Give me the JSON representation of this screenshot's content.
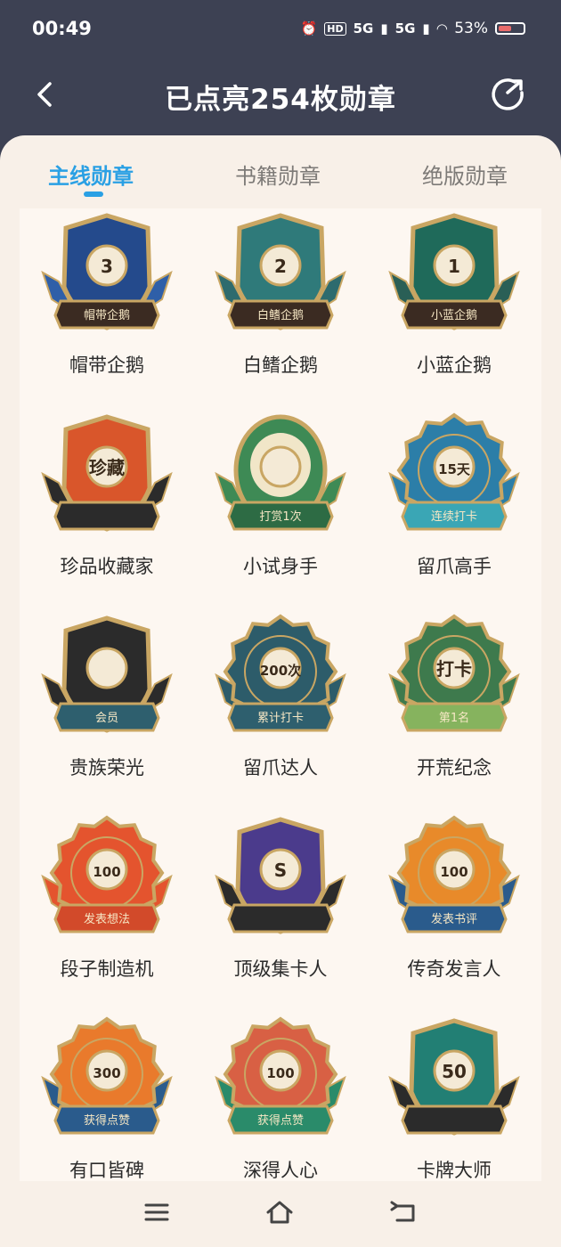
{
  "status_bar": {
    "time": "00:49",
    "network_1": "5G",
    "network_2": "5G",
    "battery": "53%"
  },
  "header": {
    "title": "已点亮254枚勋章"
  },
  "tabs": [
    {
      "label": "主线勋章",
      "active": true
    },
    {
      "label": "书籍勋章",
      "active": false
    },
    {
      "label": "绝版勋章",
      "active": false
    }
  ],
  "badges": [
    {
      "name": "帽带企鹅",
      "ribbon": "帽带企鹅",
      "center": "3"
    },
    {
      "name": "白鳍企鹅",
      "ribbon": "白鳍企鹅",
      "center": "2"
    },
    {
      "name": "小蓝企鹅",
      "ribbon": "小蓝企鹅",
      "center": "1"
    },
    {
      "name": "珍品收藏家",
      "ribbon": "",
      "center": "珍藏"
    },
    {
      "name": "小试身手",
      "ribbon": "打赏1次",
      "center": ""
    },
    {
      "name": "留爪高手",
      "ribbon": "连续打卡",
      "center": "15天"
    },
    {
      "name": "贵族荣光",
      "ribbon": "会员",
      "center": ""
    },
    {
      "name": "留爪达人",
      "ribbon": "累计打卡",
      "center": "200次"
    },
    {
      "name": "开荒纪念",
      "ribbon": "第1名",
      "center": "打卡"
    },
    {
      "name": "段子制造机",
      "ribbon": "发表想法",
      "center": "100"
    },
    {
      "name": "顶级集卡人",
      "ribbon": "",
      "center": "S"
    },
    {
      "name": "传奇发言人",
      "ribbon": "发表书评",
      "center": "100"
    },
    {
      "name": "有口皆碑",
      "ribbon": "获得点赞",
      "center": "300"
    },
    {
      "name": "深得人心",
      "ribbon": "获得点赞",
      "center": "100"
    },
    {
      "name": "卡牌大师",
      "ribbon": "",
      "center": "50"
    }
  ],
  "colors": {
    "active_tab": "#2aa0e4",
    "header_bg": "#3d4153",
    "sheet_bg": "#f8f0e8"
  }
}
